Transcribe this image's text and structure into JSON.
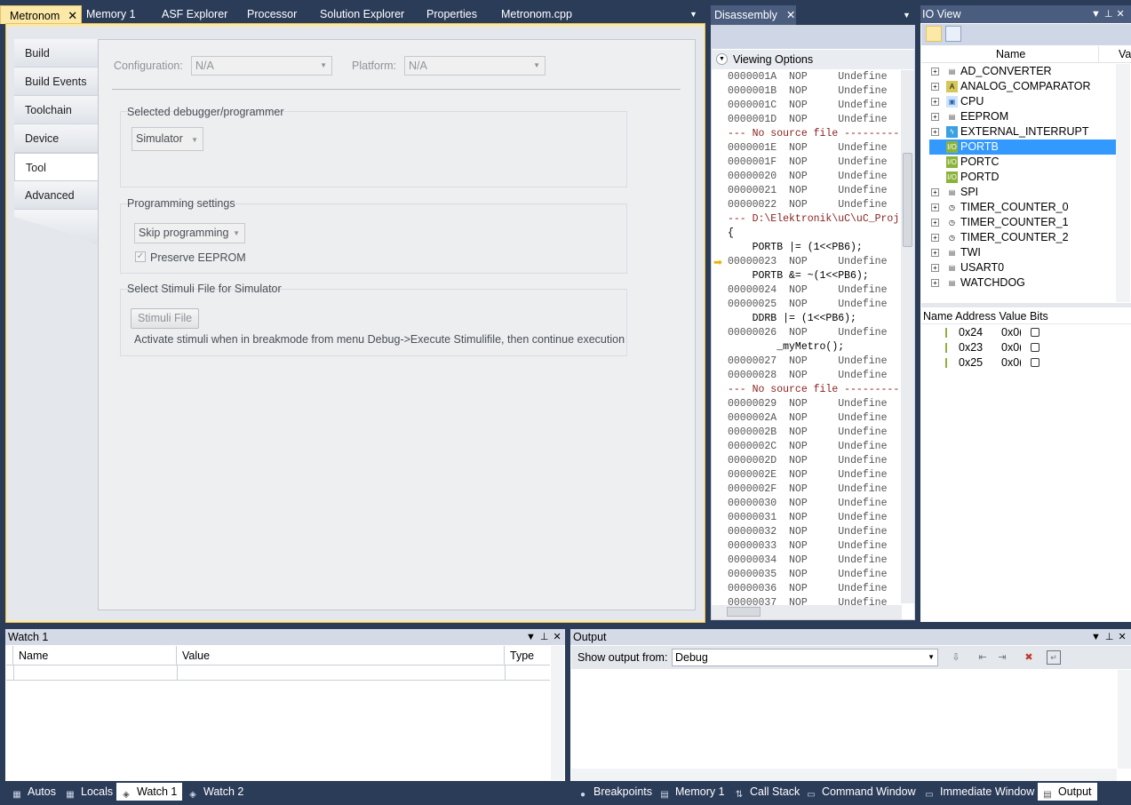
{
  "doc_tabs": [
    {
      "label": "Metronom",
      "active": true
    },
    {
      "label": "Memory 1"
    },
    {
      "label": "ASF Explorer"
    },
    {
      "label": "Processor"
    },
    {
      "label": "Solution Explorer"
    },
    {
      "label": "Properties"
    },
    {
      "label": "Metronom.cpp"
    }
  ],
  "close_glyph": "✕",
  "dropdown_glyph": "▼",
  "side_tabs": [
    "Build",
    "Build Events",
    "Toolchain",
    "Device",
    "Tool",
    "Advanced"
  ],
  "active_side_tab": "Tool",
  "tool": {
    "configuration_label": "Configuration:",
    "configuration_value": "N/A",
    "platform_label": "Platform:",
    "platform_value": "N/A",
    "debugger_group": "Selected debugger/programmer",
    "debugger_value": "Simulator",
    "programming_group": "Programming settings",
    "programming_value": "Skip programming",
    "preserve_eeprom": "Preserve EEPROM",
    "preserve_eeprom_checked": true,
    "stimuli_group": "Select Stimuli File for Simulator",
    "stimuli_button": "Stimuli File",
    "stimuli_hint": "Activate stimuli when in breakmode from menu Debug->Execute Stimulifile, then continue execution"
  },
  "disassembly": {
    "title": "Disassembly",
    "viewing_options": "Viewing Options",
    "lines": [
      {
        "kind": "asm",
        "addr": "0000001A",
        "op": "NOP",
        "note": "Undefine"
      },
      {
        "kind": "asm",
        "addr": "0000001B",
        "op": "NOP",
        "note": "Undefine"
      },
      {
        "kind": "asm",
        "addr": "0000001C",
        "op": "NOP",
        "note": "Undefine"
      },
      {
        "kind": "asm",
        "addr": "0000001D",
        "op": "NOP",
        "note": "Undefine"
      },
      {
        "kind": "nosrc",
        "text": "--- No source file ---------"
      },
      {
        "kind": "asm",
        "addr": "0000001E",
        "op": "NOP",
        "note": "Undefine"
      },
      {
        "kind": "asm",
        "addr": "0000001F",
        "op": "NOP",
        "note": "Undefine"
      },
      {
        "kind": "asm",
        "addr": "00000020",
        "op": "NOP",
        "note": "Undefine"
      },
      {
        "kind": "asm",
        "addr": "00000021",
        "op": "NOP",
        "note": "Undefine"
      },
      {
        "kind": "asm",
        "addr": "00000022",
        "op": "NOP",
        "note": "Undefine"
      },
      {
        "kind": "nosrc",
        "text": "--- D:\\Elektronik\\uC\\uC_Proj"
      },
      {
        "kind": "src",
        "text": "{"
      },
      {
        "kind": "src",
        "text": "    PORTB |= (1<<PB6);"
      },
      {
        "kind": "asm",
        "addr": "00000023",
        "op": "NOP",
        "note": "Undefine",
        "current": true
      },
      {
        "kind": "src",
        "text": "    PORTB &= ~(1<<PB6);"
      },
      {
        "kind": "asm",
        "addr": "00000024",
        "op": "NOP",
        "note": "Undefine"
      },
      {
        "kind": "asm",
        "addr": "00000025",
        "op": "NOP",
        "note": "Undefine"
      },
      {
        "kind": "src",
        "text": "    DDRB |= (1<<PB6);"
      },
      {
        "kind": "asm",
        "addr": "00000026",
        "op": "NOP",
        "note": "Undefine"
      },
      {
        "kind": "src",
        "text": "        _myMetro();"
      },
      {
        "kind": "asm",
        "addr": "00000027",
        "op": "NOP",
        "note": "Undefine"
      },
      {
        "kind": "asm",
        "addr": "00000028",
        "op": "NOP",
        "note": "Undefine"
      },
      {
        "kind": "nosrc",
        "text": "--- No source file ---------"
      },
      {
        "kind": "asm",
        "addr": "00000029",
        "op": "NOP",
        "note": "Undefine"
      },
      {
        "kind": "asm",
        "addr": "0000002A",
        "op": "NOP",
        "note": "Undefine"
      },
      {
        "kind": "asm",
        "addr": "0000002B",
        "op": "NOP",
        "note": "Undefine"
      },
      {
        "kind": "asm",
        "addr": "0000002C",
        "op": "NOP",
        "note": "Undefine"
      },
      {
        "kind": "asm",
        "addr": "0000002D",
        "op": "NOP",
        "note": "Undefine"
      },
      {
        "kind": "asm",
        "addr": "0000002E",
        "op": "NOP",
        "note": "Undefine"
      },
      {
        "kind": "asm",
        "addr": "0000002F",
        "op": "NOP",
        "note": "Undefine"
      },
      {
        "kind": "asm",
        "addr": "00000030",
        "op": "NOP",
        "note": "Undefine"
      },
      {
        "kind": "asm",
        "addr": "00000031",
        "op": "NOP",
        "note": "Undefine"
      },
      {
        "kind": "asm",
        "addr": "00000032",
        "op": "NOP",
        "note": "Undefine"
      },
      {
        "kind": "asm",
        "addr": "00000033",
        "op": "NOP",
        "note": "Undefine"
      },
      {
        "kind": "asm",
        "addr": "00000034",
        "op": "NOP",
        "note": "Undefine"
      },
      {
        "kind": "asm",
        "addr": "00000035",
        "op": "NOP",
        "note": "Undefine"
      },
      {
        "kind": "asm",
        "addr": "00000036",
        "op": "NOP",
        "note": "Undefine"
      },
      {
        "kind": "asm",
        "addr": "00000037",
        "op": "NOP",
        "note": "Undefine"
      }
    ]
  },
  "io_view": {
    "title": "IO View",
    "col_name": "Name",
    "col_value": "Va",
    "items": [
      {
        "label": "AD_CONVERTER",
        "icon": "doc-icon",
        "expand": true
      },
      {
        "label": "ANALOG_COMPARATOR",
        "icon": "adc-icon",
        "expand": true
      },
      {
        "label": "CPU",
        "icon": "chip-icon",
        "expand": true
      },
      {
        "label": "EEPROM",
        "icon": "doc-icon",
        "expand": true
      },
      {
        "label": "EXTERNAL_INTERRUPT",
        "icon": "interrupt-icon",
        "expand": true
      },
      {
        "label": "PORTB",
        "icon": "io-icon",
        "expand": false,
        "selected": true
      },
      {
        "label": "PORTC",
        "icon": "io-icon",
        "expand": false
      },
      {
        "label": "PORTD",
        "icon": "io-icon",
        "expand": false
      },
      {
        "label": "SPI",
        "icon": "doc-icon",
        "expand": true
      },
      {
        "label": "TIMER_COUNTER_0",
        "icon": "clock-icon",
        "expand": true
      },
      {
        "label": "TIMER_COUNTER_1",
        "icon": "clock-icon",
        "expand": true
      },
      {
        "label": "TIMER_COUNTER_2",
        "icon": "clock-icon",
        "expand": true
      },
      {
        "label": "TWI",
        "icon": "doc-icon",
        "expand": true
      },
      {
        "label": "USART0",
        "icon": "doc-icon",
        "expand": true
      },
      {
        "label": "WATCHDOG",
        "icon": "doc-icon",
        "expand": true
      }
    ],
    "detail_header": "Name Address Value Bits",
    "registers": [
      {
        "address": "0x24",
        "value": "0x0("
      },
      {
        "address": "0x23",
        "value": "0x0("
      },
      {
        "address": "0x25",
        "value": "0x0("
      }
    ]
  },
  "watch": {
    "title": "Watch 1",
    "columns": [
      "Name",
      "Value",
      "Type"
    ]
  },
  "output": {
    "title": "Output",
    "show_from_label": "Show output from:",
    "source": "Debug"
  },
  "bottom_tabs_left": [
    {
      "label": "Autos",
      "icon": "autos-icon"
    },
    {
      "label": "Locals",
      "icon": "locals-icon"
    },
    {
      "label": "Watch 1",
      "icon": "watch-icon",
      "active": true
    },
    {
      "label": "Watch 2",
      "icon": "watch-icon"
    }
  ],
  "bottom_tabs_right": [
    {
      "label": "Breakpoints",
      "icon": "breakpoints-icon"
    },
    {
      "label": "Memory 1",
      "icon": "memory-icon"
    },
    {
      "label": "Call Stack",
      "icon": "callstack-icon"
    },
    {
      "label": "Command Window",
      "icon": "command-icon"
    },
    {
      "label": "Immediate Window",
      "icon": "immediate-icon"
    },
    {
      "label": "Output",
      "icon": "output-icon",
      "active": true
    }
  ],
  "colors": {
    "ide_background": "#2b3c59",
    "active_doc_tab": "#fce9a8",
    "selection": "#3399ff",
    "current_line_arrow": "#e4b400"
  }
}
